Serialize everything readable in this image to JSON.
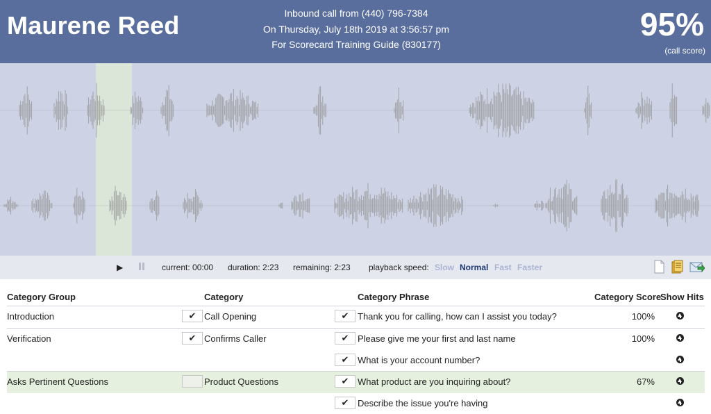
{
  "header": {
    "caller_name": "Maurene Reed",
    "call_line": "Inbound call from (440) 796-7384",
    "date_line": "On Thursday, July 18th 2019 at 3:56:57 pm",
    "scorecard_line": "For Scorecard Training Guide (830177)",
    "score": "95%",
    "score_caption": "(call score)"
  },
  "player": {
    "current_label": "current: 00:00",
    "duration_label": "duration: 2:23",
    "remaining_label": "remaining: 2:23",
    "speed_label": "playback speed:",
    "speeds": [
      {
        "label": "Slow",
        "active": false
      },
      {
        "label": "Normal",
        "active": true
      },
      {
        "label": "Fast",
        "active": false
      },
      {
        "label": "Faster",
        "active": false
      }
    ],
    "play_icon": "play-icon",
    "pause_icon": "pause-icon",
    "tools": [
      "document-icon",
      "notes-icon",
      "email-icon"
    ]
  },
  "colors": {
    "header_bg": "#5a6e9e",
    "waveform_bg": "#cdd3e5",
    "waveform_wave": "#9a9a9a",
    "playhead_region": "#dbe6d9",
    "row_highlight": "#e5f0de",
    "speed_active": "#1e3872",
    "speed_inactive": "#aab3d3"
  },
  "table": {
    "headers": {
      "group": "Category Group",
      "category": "Category",
      "phrase": "Category Phrase",
      "score": "Category Score",
      "hits": "Show Hits"
    },
    "rows": [
      {
        "group": "Introduction",
        "category": "Call Opening",
        "category_checked": true,
        "phrase": "Thank you for calling, how can I assist you today?",
        "phrase_checked": true,
        "score": "100%",
        "highlight": false
      },
      {
        "group": "Verification",
        "category": "Confirms Caller",
        "category_checked": true,
        "phrase": "Please give me your first and last name",
        "phrase_checked": true,
        "score": "100%",
        "highlight": false
      },
      {
        "group": "",
        "category": "",
        "category_checked": null,
        "phrase": "What is your account number?",
        "phrase_checked": true,
        "score": "",
        "highlight": false
      },
      {
        "group": "Asks Pertinent Questions",
        "category": "Product Questions",
        "category_checked": false,
        "phrase": "What product are you inquiring about?",
        "phrase_checked": true,
        "score": "67%",
        "highlight": true
      },
      {
        "group": "",
        "category": "",
        "category_checked": null,
        "phrase": "Describe the issue you're having",
        "phrase_checked": true,
        "score": "",
        "highlight": false
      }
    ]
  }
}
